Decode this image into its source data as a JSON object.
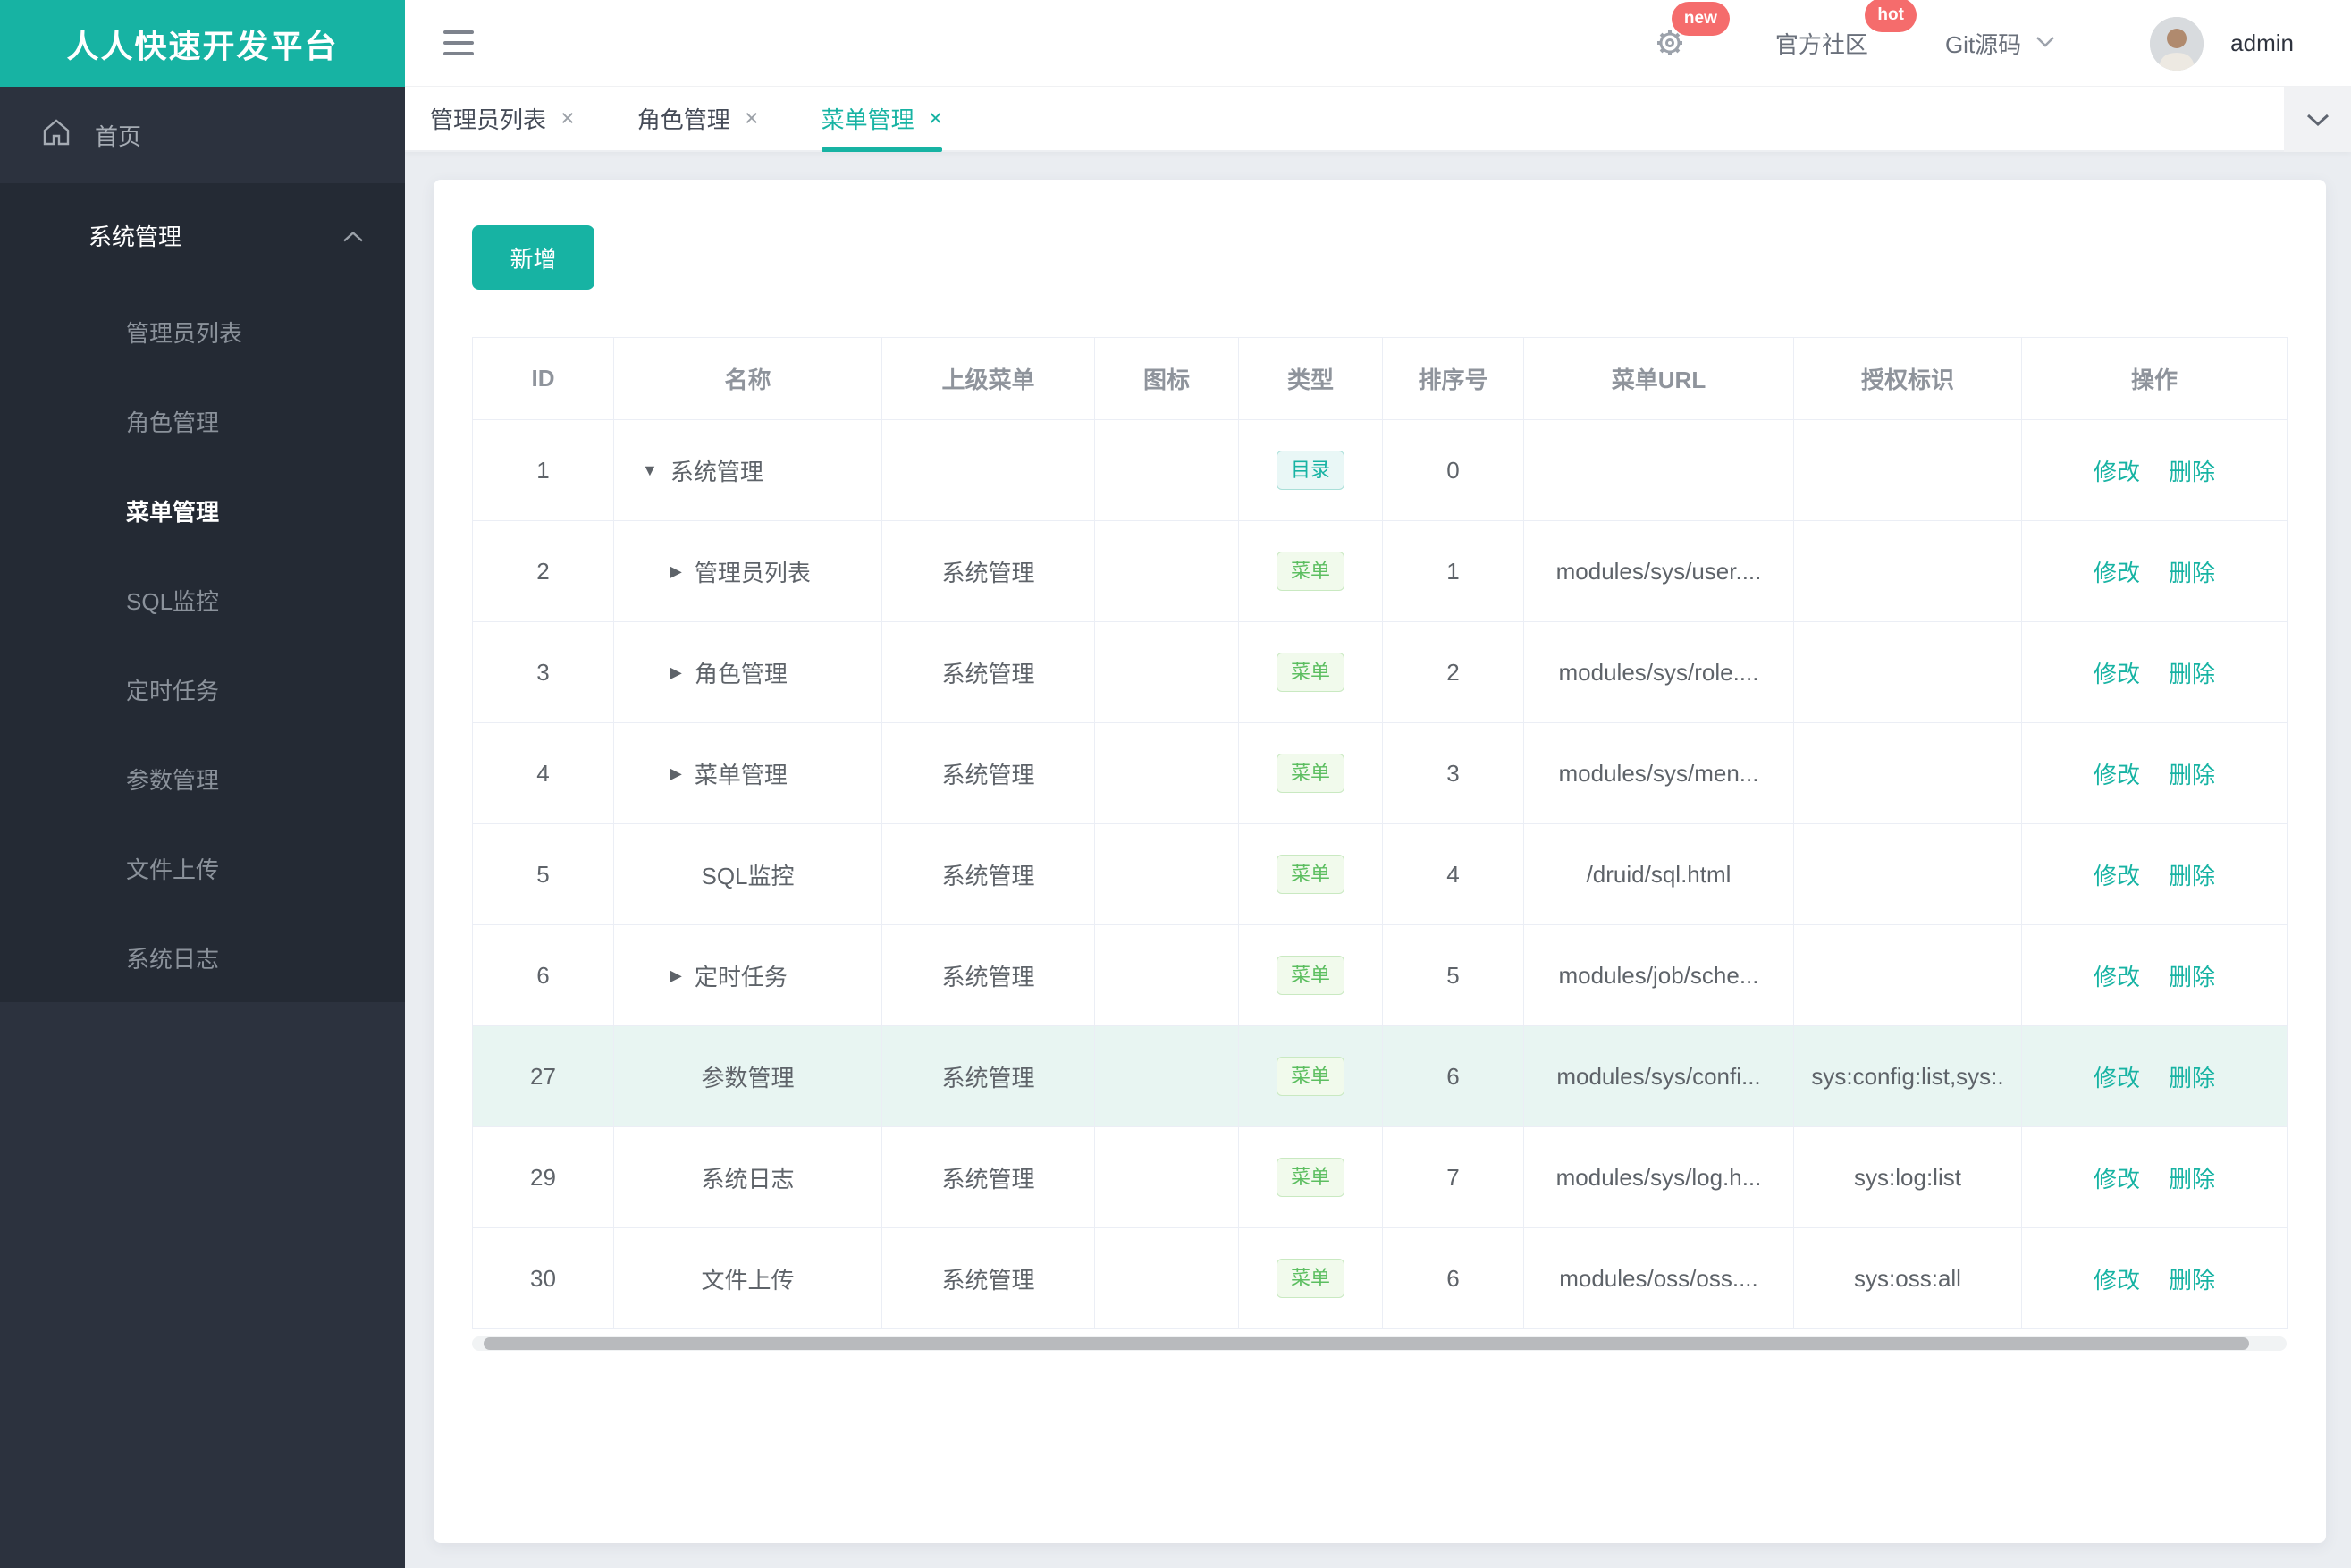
{
  "app": {
    "title": "人人快速开发平台"
  },
  "colors": {
    "brand_teal": "#17B3A3",
    "badge_red": "#F56C6C",
    "sidebar_bg": "#2C323E",
    "sidebar_panel_bg": "#242A34",
    "current_row_bg": "#E8F5F2",
    "menu_badge_green": "#5CBE60"
  },
  "sidebar": {
    "home_label": "首页",
    "group": {
      "title": "系统管理",
      "items": [
        {
          "label": "管理员列表",
          "active": false
        },
        {
          "label": "角色管理",
          "active": false
        },
        {
          "label": "菜单管理",
          "active": true
        },
        {
          "label": "SQL监控",
          "active": false
        },
        {
          "label": "定时任务",
          "active": false
        },
        {
          "label": "参数管理",
          "active": false
        },
        {
          "label": "文件上传",
          "active": false
        },
        {
          "label": "系统日志",
          "active": false
        }
      ]
    }
  },
  "topbar": {
    "badge_new": "new",
    "community_label": "官方社区",
    "badge_hot": "hot",
    "git_label": "Git源码",
    "username": "admin"
  },
  "tabbar": {
    "close_glyph": "×",
    "tabs": [
      {
        "label": "管理员列表",
        "active": false
      },
      {
        "label": "角色管理",
        "active": false
      },
      {
        "label": "菜单管理",
        "active": true
      }
    ]
  },
  "toolbar": {
    "add_label": "新增"
  },
  "table": {
    "columns": [
      "ID",
      "名称",
      "上级菜单",
      "图标",
      "类型",
      "排序号",
      "菜单URL",
      "授权标识",
      "操作"
    ],
    "type_badges": {
      "dir": "目录",
      "menu": "菜单"
    },
    "actions": {
      "edit": "修改",
      "delete": "删除"
    },
    "arrows": {
      "down": "▼",
      "right": "▶"
    },
    "rows": [
      {
        "id": "1",
        "name": "系统管理",
        "arrow": "down",
        "indent": 0,
        "parent": "",
        "icon": "",
        "type": "dir",
        "order": "0",
        "url": "",
        "perms": "",
        "current": false
      },
      {
        "id": "2",
        "name": "管理员列表",
        "arrow": "right",
        "indent": 1,
        "parent": "系统管理",
        "icon": "",
        "type": "menu",
        "order": "1",
        "url": "modules/sys/user....",
        "perms": "",
        "current": false
      },
      {
        "id": "3",
        "name": "角色管理",
        "arrow": "right",
        "indent": 1,
        "parent": "系统管理",
        "icon": "",
        "type": "menu",
        "order": "2",
        "url": "modules/sys/role....",
        "perms": "",
        "current": false
      },
      {
        "id": "4",
        "name": "菜单管理",
        "arrow": "right",
        "indent": 1,
        "parent": "系统管理",
        "icon": "",
        "type": "menu",
        "order": "3",
        "url": "modules/sys/men...",
        "perms": "",
        "current": false
      },
      {
        "id": "5",
        "name": "SQL监控",
        "arrow": null,
        "indent": 1,
        "parent": "系统管理",
        "icon": "",
        "type": "menu",
        "order": "4",
        "url": "/druid/sql.html",
        "perms": "",
        "current": false
      },
      {
        "id": "6",
        "name": "定时任务",
        "arrow": "right",
        "indent": 1,
        "parent": "系统管理",
        "icon": "",
        "type": "menu",
        "order": "5",
        "url": "modules/job/sche...",
        "perms": "",
        "current": false
      },
      {
        "id": "27",
        "name": "参数管理",
        "arrow": null,
        "indent": 1,
        "parent": "系统管理",
        "icon": "",
        "type": "menu",
        "order": "6",
        "url": "modules/sys/confi...",
        "perms": "sys:config:list,sys:.",
        "current": true
      },
      {
        "id": "29",
        "name": "系统日志",
        "arrow": null,
        "indent": 1,
        "parent": "系统管理",
        "icon": "",
        "type": "menu",
        "order": "7",
        "url": "modules/sys/log.h...",
        "perms": "sys:log:list",
        "current": false
      },
      {
        "id": "30",
        "name": "文件上传",
        "arrow": null,
        "indent": 1,
        "parent": "系统管理",
        "icon": "",
        "type": "menu",
        "order": "6",
        "url": "modules/oss/oss....",
        "perms": "sys:oss:all",
        "current": false
      }
    ]
  }
}
